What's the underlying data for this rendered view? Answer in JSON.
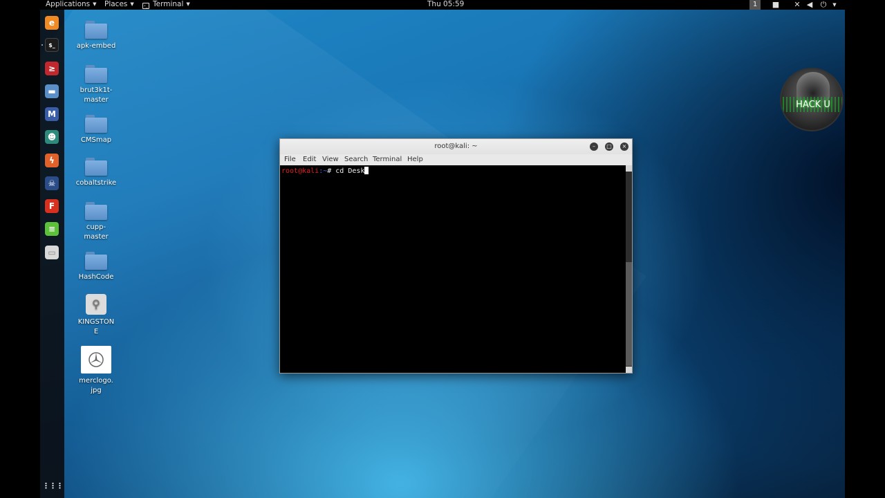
{
  "top_panel": {
    "applications_label": "Applications",
    "places_label": "Places",
    "terminal_label": "Terminal",
    "clock": "Thu 05:59",
    "workspace": "1"
  },
  "dock": {
    "items": [
      {
        "name": "firefox-icon",
        "color": "#f08a24",
        "glyph": "e"
      },
      {
        "name": "terminal-icon",
        "color": "#1c1c1c",
        "glyph": "$_"
      },
      {
        "name": "metasploit-icon",
        "color": "#c0282d",
        "glyph": "≥"
      },
      {
        "name": "files-icon",
        "color": "#5b8fc8",
        "glyph": "▬"
      },
      {
        "name": "maltego-icon",
        "color": "#3a5da8",
        "glyph": "M"
      },
      {
        "name": "armitage-icon",
        "color": "#2e8a7a",
        "glyph": "☻"
      },
      {
        "name": "burpsuite-icon",
        "color": "#e0622a",
        "glyph": "ϟ"
      },
      {
        "name": "beef-icon",
        "color": "#2a4d8a",
        "glyph": "☠"
      },
      {
        "name": "faraday-icon",
        "color": "#d8301f",
        "glyph": "F"
      },
      {
        "name": "text-editor-icon",
        "color": "#5cc23a",
        "glyph": "≡"
      },
      {
        "name": "usb-drive-icon",
        "color": "#d9d9d9",
        "glyph": "▭"
      }
    ],
    "show_apps_glyph": "⋮⋮⋮"
  },
  "desktop_icons": [
    {
      "label": "apk-embed",
      "type": "folder"
    },
    {
      "label": "brut3k1t-\nmaster",
      "type": "folder"
    },
    {
      "label": "CMSmap",
      "type": "folder"
    },
    {
      "label": "cobaltstrike",
      "type": "folder"
    },
    {
      "label": "cupp-\nmaster",
      "type": "folder"
    },
    {
      "label": "HashCode",
      "type": "folder"
    },
    {
      "label": "KINGSTON\nE",
      "type": "usb"
    },
    {
      "label": "merclogo.\njpg",
      "type": "image"
    }
  ],
  "badge": {
    "label": "HACK U"
  },
  "terminal": {
    "title": "root@kali: ~",
    "menu": [
      "File",
      "Edit",
      "View",
      "Search",
      "Terminal",
      "Help"
    ],
    "prompt_user": "root@kali",
    "prompt_path": ":~",
    "prompt_symbol": "# ",
    "command": "cd Desk"
  }
}
